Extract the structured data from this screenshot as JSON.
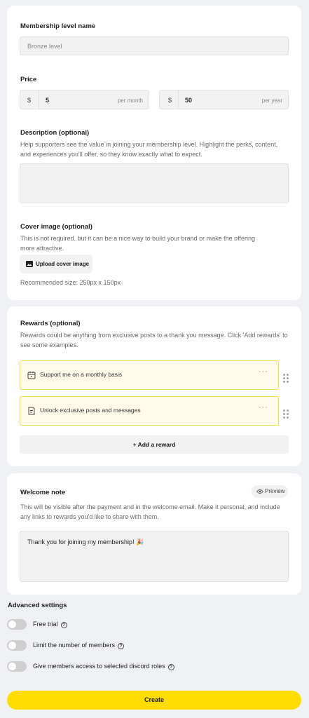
{
  "membership": {
    "name_label": "Membership level name",
    "name_placeholder": "Bronze level"
  },
  "price": {
    "label": "Price",
    "currency": "$",
    "monthly_value": "5",
    "monthly_unit": "per month",
    "yearly_value": "50",
    "yearly_unit": "per year"
  },
  "description": {
    "label": "Description (optional)",
    "help": "Help supporters see the value in joining your membership level. Highlight the perks, content, and experiences you'll offer, so they know exactly what to expect."
  },
  "cover": {
    "label": "Cover image (optional)",
    "help": "This is not required, but it can be a nice way to build your brand or make the offering more attractive.",
    "upload_label": "Upload cover image",
    "recommended": "Recommended size: 250px x 150px"
  },
  "rewards": {
    "label": "Rewards (optional)",
    "help": "Rewards could be anything from exclusive posts to a thank you message. Click 'Add rewards' to see some examples.",
    "items": [
      {
        "label": "Support me on a monthly basis",
        "icon": "calendar-icon"
      },
      {
        "label": "Unlock exclusive posts and messages",
        "icon": "document-icon"
      }
    ],
    "more_glyph": "···",
    "add_label": "+ Add a reward"
  },
  "welcome": {
    "label": "Welcome note",
    "preview_label": "Preview",
    "help": "This will be visible after the payment and in the welcome email. Make it personal, and include any links to rewards you'd like to share with them.",
    "message": "Thank you for joining my membership! 🎉"
  },
  "advanced": {
    "label": "Advanced settings",
    "toggles": [
      {
        "label": "Free trial",
        "on": false
      },
      {
        "label": "Limit the number of members",
        "on": false
      },
      {
        "label": "Give members access to selected discord roles",
        "on": false
      }
    ],
    "help_glyph": "?"
  },
  "create_label": "Create",
  "colors": {
    "accent": "#ffdd00",
    "reward_bg": "#fffcec",
    "reward_border": "#f2de4d",
    "page_bg": "#f0f1f4"
  }
}
